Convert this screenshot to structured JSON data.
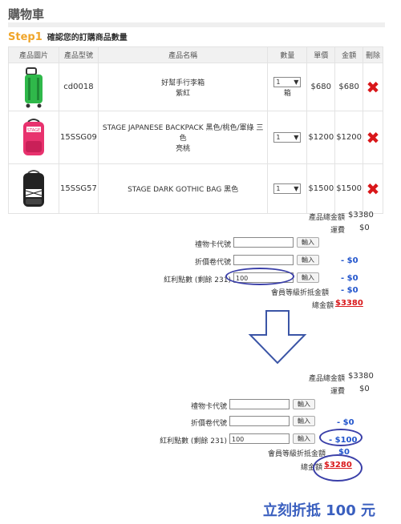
{
  "page": {
    "title": "購物車"
  },
  "step": {
    "number": "Step1",
    "label": "確認您的訂購商品數量"
  },
  "table": {
    "headers": [
      "產品圖片",
      "產品型號",
      "產品名稱",
      "數量",
      "單價",
      "金額",
      "刪除"
    ],
    "rows": [
      {
        "model": "cd0018",
        "name_line1": "好幫手行李箱",
        "name_line2": "紫紅",
        "name_line3": "",
        "qty": "1",
        "unit_note": "箱",
        "price": "$680",
        "amount": "$680",
        "image_icon": "green-suitcase-icon",
        "image_color": "#2fb84a"
      },
      {
        "model": "15SSG09",
        "name_line1": "STAGE JAPANESE BACKPACK 黑色/桃色/軍綠 三",
        "name_line2": "色",
        "name_line3": "亮桃",
        "qty": "1",
        "unit_note": "",
        "price": "$1200",
        "amount": "$1200",
        "image_icon": "pink-backpack-icon",
        "image_color": "#e8326e"
      },
      {
        "model": "15SSG57",
        "name_line1": "STAGE DARK GOTHIC BAG 黑色",
        "name_line2": "",
        "name_line3": "",
        "qty": "1",
        "unit_note": "",
        "price": "$1500",
        "amount": "$1500",
        "image_icon": "black-backpack-icon",
        "image_color": "#222222"
      }
    ]
  },
  "before": {
    "subtotal_label": "產品總金額",
    "subtotal_value": "$3380",
    "shipping_label": "運費",
    "shipping_value": "$0",
    "giftcard_label": "禮物卡代號",
    "giftcard_button": "輸入",
    "coupon_label": "折價卷代號",
    "coupon_button": "輸入",
    "coupon_discount": "- $0",
    "points_label": "紅利點數 (剩餘 231)",
    "points_value": "100",
    "points_button": "輸入",
    "points_discount": "- $0",
    "member_label": "會員等級折抵金額",
    "member_discount": "- $0",
    "total_label": "總金額",
    "total_value": "$3380"
  },
  "after": {
    "subtotal_label": "產品總金額",
    "subtotal_value": "$3380",
    "shipping_label": "運費",
    "shipping_value": "$0",
    "giftcard_label": "禮物卡代號",
    "giftcard_button": "輸入",
    "coupon_label": "折價卷代號",
    "coupon_button": "輸入",
    "coupon_discount": "- $0",
    "points_label": "紅利點數 (剩餘 231)",
    "points_value": "100",
    "points_button": "輸入",
    "points_discount": "- $100",
    "member_label": "會員等級折抵金額",
    "member_discount": "$0",
    "total_label": "總金額",
    "total_value": "$3280"
  },
  "caption": "立刻折抵 100 元",
  "colors": {
    "accent_orange": "#f0a52a",
    "delete_red": "#d9171a",
    "annotation_blue": "#3a3fa8"
  }
}
